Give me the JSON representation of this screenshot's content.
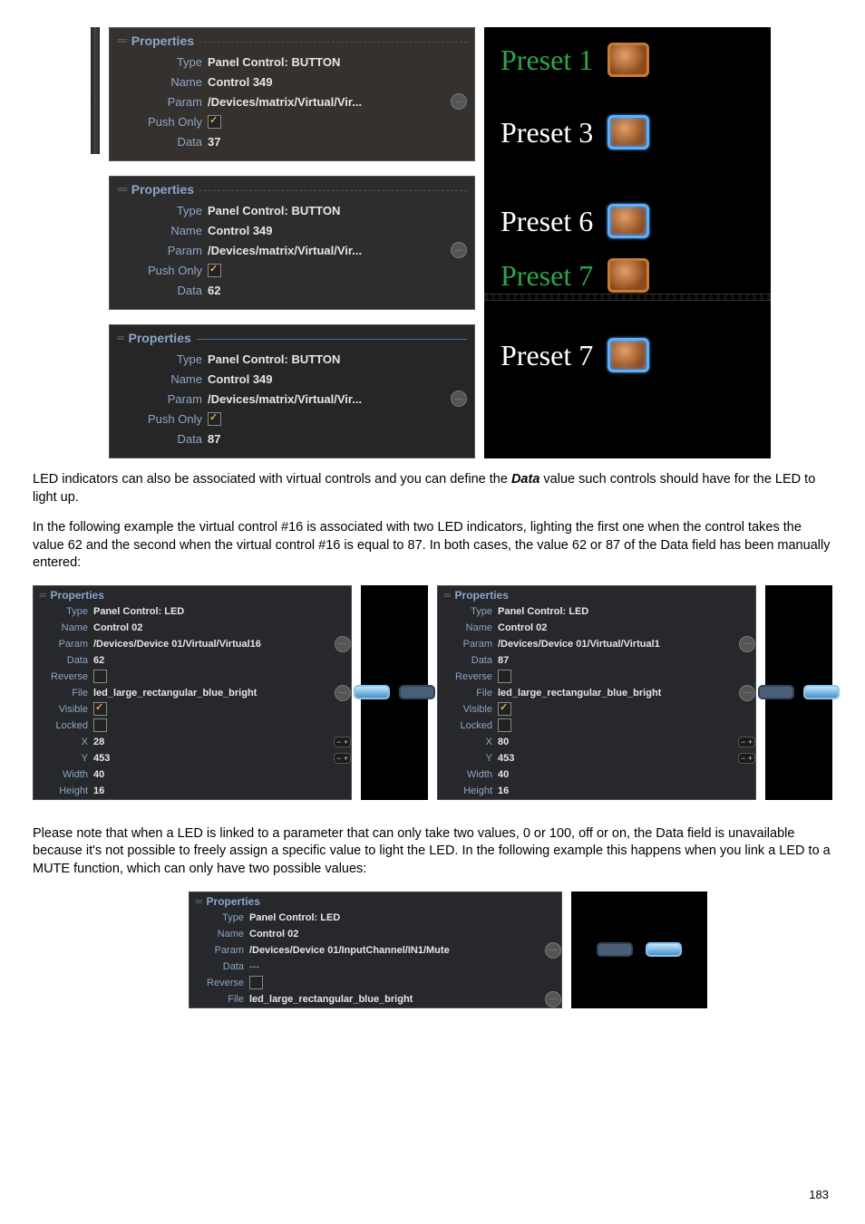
{
  "page_number": "183",
  "labels": {
    "properties": "Properties",
    "type": "Type",
    "name": "Name",
    "param": "Param",
    "push_only": "Push Only",
    "data": "Data",
    "reverse": "Reverse",
    "file": "File",
    "visible": "Visible",
    "locked": "Locked",
    "x": "X",
    "y": "Y",
    "width": "Width",
    "height": "Height"
  },
  "top_panels": [
    {
      "type": "Panel Control: BUTTON",
      "name": "Control 349",
      "param": "/Devices/matrix/Virtual/Vir...",
      "push_only": true,
      "data": "37"
    },
    {
      "type": "Panel Control: BUTTON",
      "name": "Control 349",
      "param": "/Devices/matrix/Virtual/Vir...",
      "push_only": true,
      "data": "62"
    },
    {
      "type": "Panel Control: BUTTON",
      "name": "Control 349",
      "param": "/Devices/matrix/Virtual/Vir...",
      "push_only": true,
      "data": "87"
    }
  ],
  "presets": {
    "list1": [
      {
        "label": "Preset 1",
        "lit": false,
        "green": true
      },
      {
        "label": "Preset 3",
        "lit": true
      }
    ],
    "list2": [
      {
        "label": "Preset 6",
        "lit": true
      },
      {
        "label": "Preset 7",
        "lit": false,
        "green": true
      }
    ],
    "list3": [
      {
        "label": "Preset 7",
        "lit": true
      }
    ]
  },
  "paragraph1": "LED indicators can also be associated with virtual controls and you can define the Data value such controls should have for the LED to light up.",
  "paragraph2": "In the following example the virtual control #16 is associated with two LED indicators, lighting the first one when the control takes the value 62 and the second when the virtual control #16 is equal to 87. In both cases, the value 62 or 87 of the Data field has been manually entered:",
  "led_panels": [
    {
      "type": "Panel Control: LED",
      "name": "Control 02",
      "param": "/Devices/Device 01/Virtual/Virtual16",
      "data": "62",
      "reverse": false,
      "file": "led_large_rectangular_blue_bright",
      "visible": true,
      "locked": false,
      "x": "28",
      "y": "453",
      "width": "40",
      "height": "16",
      "preview_lit": false
    },
    {
      "type": "Panel Control: LED",
      "name": "Control 02",
      "param": "/Devices/Device 01/Virtual/Virtual1",
      "data": "87",
      "reverse": false,
      "file": "led_large_rectangular_blue_bright",
      "visible": true,
      "locked": false,
      "x": "80",
      "y": "453",
      "width": "40",
      "height": "16",
      "preview_lit": true
    }
  ],
  "paragraph3": "Please note that when a LED is linked to a parameter that can only take two values, 0 or 100, off or on, the Data field is unavailable because it's not possible to freely assign a specific value to light the LED. In the following example this happens when you link a LED to a MUTE function, which can only have two possible values:",
  "bottom_panel": {
    "type": "Panel Control: LED",
    "name": "Control 02",
    "param": "/Devices/Device 01/InputChannel/IN1/Mute",
    "data": "---",
    "reverse": false,
    "file": "led_large_rectangular_blue_bright"
  }
}
